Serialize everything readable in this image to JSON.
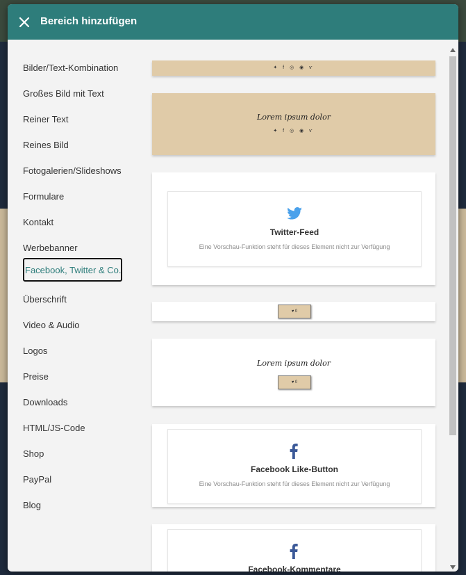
{
  "modal": {
    "title": "Bereich hinzufügen"
  },
  "sidebar": {
    "items": [
      {
        "label": "Bilder/Text-Kombination"
      },
      {
        "label": "Großes Bild mit Text"
      },
      {
        "label": "Reiner Text"
      },
      {
        "label": "Reines Bild"
      },
      {
        "label": "Fotogalerien/Slideshows"
      },
      {
        "label": "Formulare"
      },
      {
        "label": "Kontakt"
      },
      {
        "label": "Werbebanner"
      },
      {
        "label": "Facebook, Twitter & Co.",
        "active": true
      },
      {
        "label": "Überschrift"
      },
      {
        "label": "Video & Audio"
      },
      {
        "label": "Logos"
      },
      {
        "label": "Preise"
      },
      {
        "label": "Downloads"
      },
      {
        "label": "HTML/JS-Code"
      },
      {
        "label": "Shop"
      },
      {
        "label": "PayPal"
      },
      {
        "label": "Blog"
      }
    ]
  },
  "content": {
    "social_icons": "✦ f ◎ ◉ ѵ",
    "lorem": "Lorem ipsum dolor",
    "mini_button": "♥ 0",
    "twitter": {
      "title": "Twitter-Feed",
      "desc": "Eine Vorschau-Funktion steht für dieses Element nicht zur Verfügung"
    },
    "fb_like": {
      "title": "Facebook Like-Button",
      "desc": "Eine Vorschau-Funktion steht für dieses Element nicht zur Verfügung"
    },
    "fb_comments": {
      "title": "Facebook-Kommentare"
    }
  },
  "colors": {
    "header": "#2e7d7b",
    "tan": "#e0cba8",
    "twitter": "#4aa1eb",
    "facebook": "#3b5998"
  }
}
